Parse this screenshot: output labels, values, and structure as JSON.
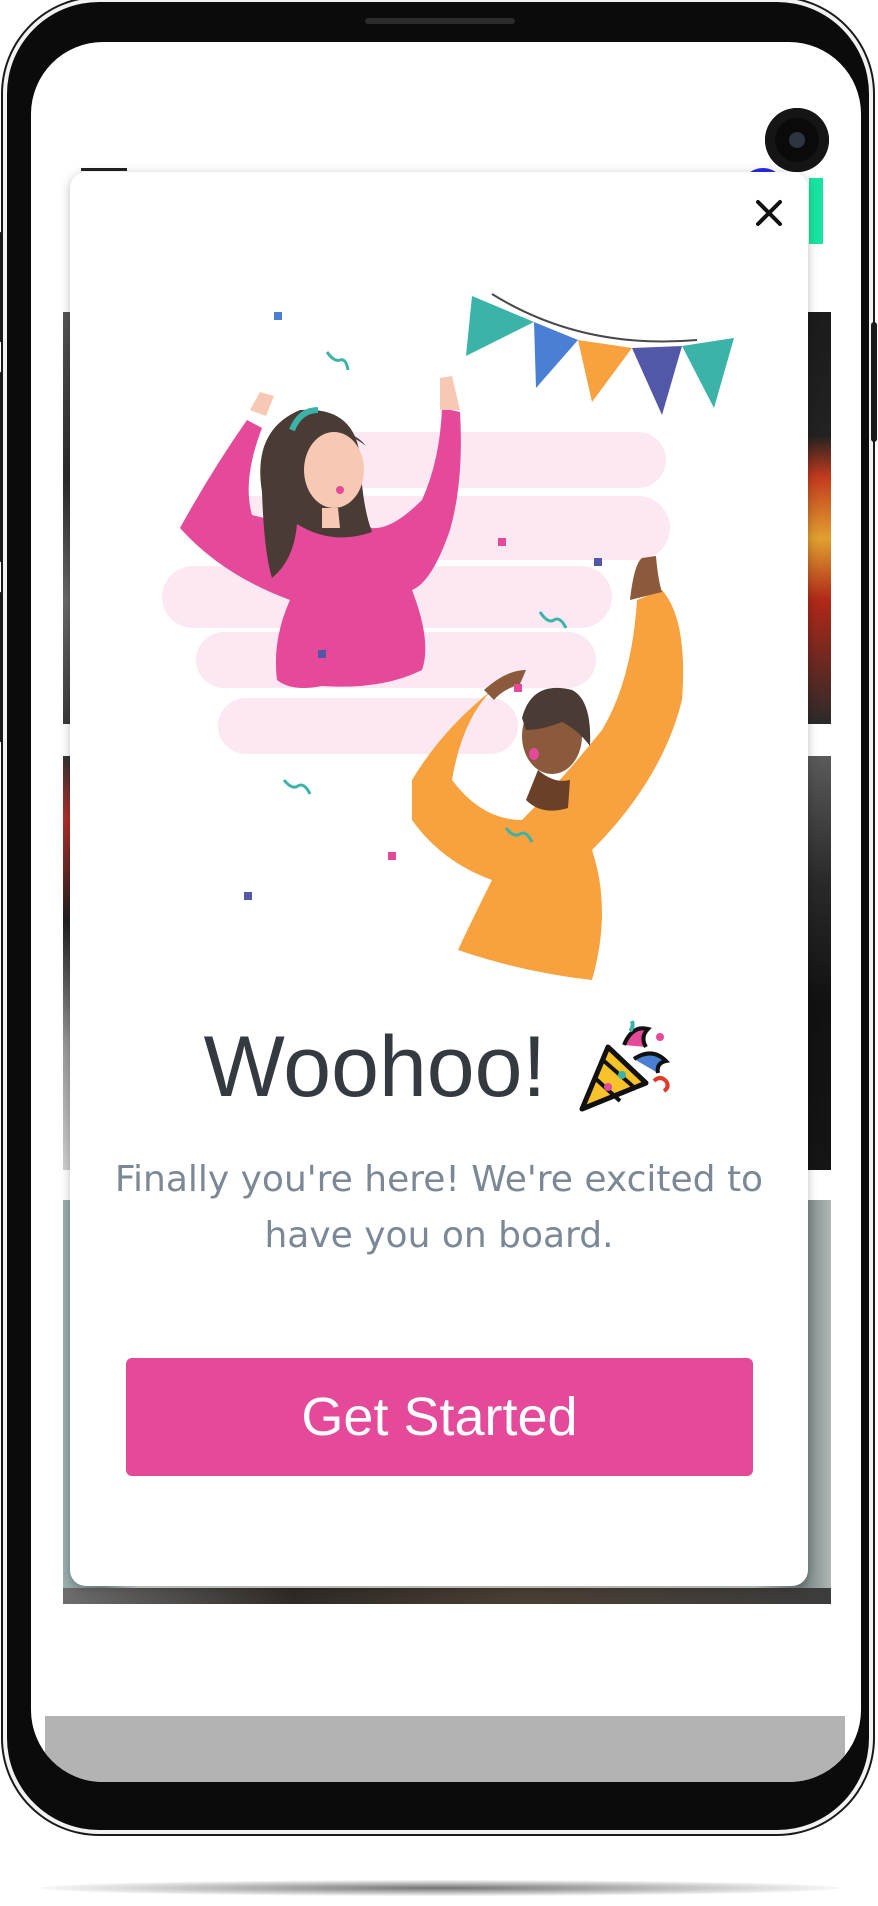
{
  "modal": {
    "close_glyph": "✕",
    "title": "Woohoo!",
    "title_icon": "party-popper-icon",
    "subtitle": "Finally you're here! We're excited to have you on board.",
    "cta_label": "Get Started"
  },
  "colors": {
    "cta": "#e4499a",
    "title": "#343a40",
    "subtitle": "#7b8896",
    "accent_teal": "#3bb3a9",
    "accent_pink": "#e4499a",
    "accent_orange": "#f7a23e",
    "accent_blue": "#4a7fd4",
    "accent_indigo": "#5257a8"
  }
}
